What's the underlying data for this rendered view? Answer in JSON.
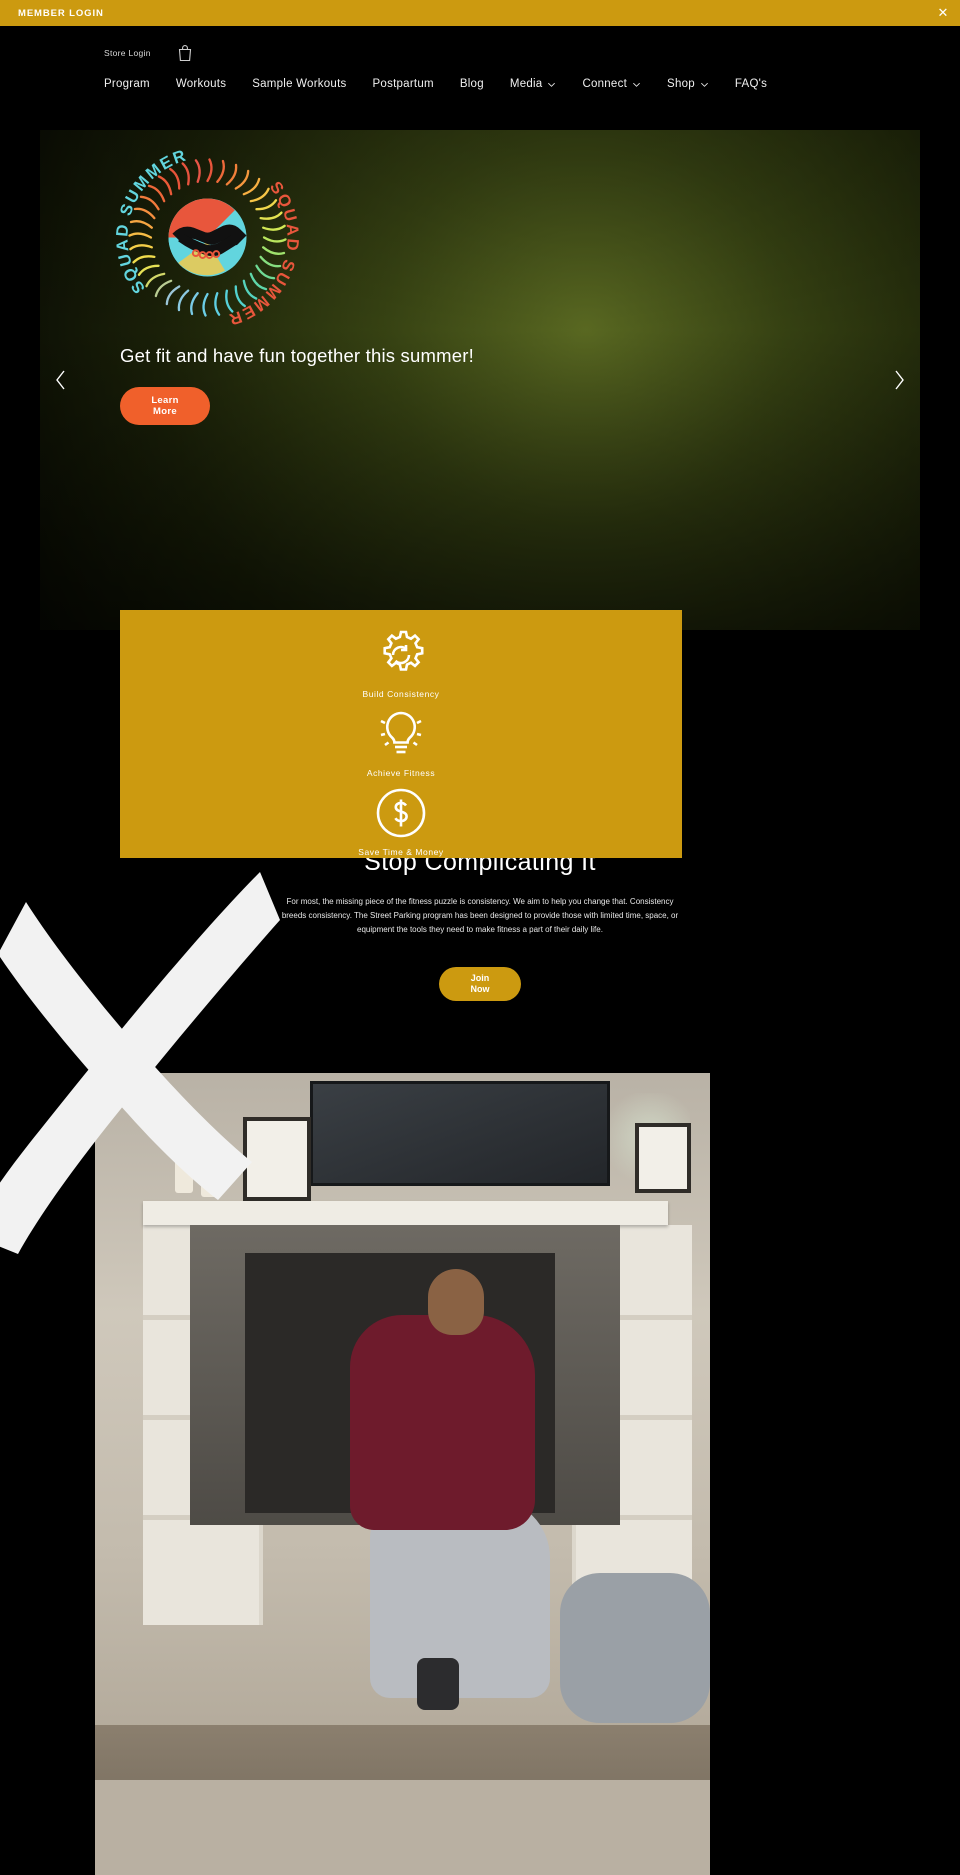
{
  "member_bar": {
    "text": "MEMBER LOGIN",
    "close_icon": "close-icon",
    "bg_color": "#CC9A10"
  },
  "header": {
    "store_login": "Store Login",
    "bag_icon": "shopping-bag-icon",
    "nav": [
      {
        "label": "Program",
        "has_caret": false
      },
      {
        "label": "Workouts",
        "has_caret": false
      },
      {
        "label": "Sample Workouts",
        "has_caret": false
      },
      {
        "label": "Postpartum",
        "has_caret": false
      },
      {
        "label": "Blog",
        "has_caret": false
      },
      {
        "label": "Media",
        "has_caret": true
      },
      {
        "label": "Connect",
        "has_caret": true
      },
      {
        "label": "Shop",
        "has_caret": true
      },
      {
        "label": "FAQ's",
        "has_caret": false
      }
    ]
  },
  "hero": {
    "logo_text_outer": "SQUAD SUMMER",
    "logo_text_inner": "SQUAD SUMMER",
    "title": "Get fit and have fun together this summer!",
    "cta_line1": "Learn",
    "cta_line2": "More",
    "cta_color": "#F0602B",
    "prev_arrow": "chevron-left-icon",
    "next_arrow": "chevron-right-icon"
  },
  "features": {
    "bg_color": "#CC9A10",
    "items": [
      {
        "icon": "gear-refresh-icon",
        "label": "Build Consistency"
      },
      {
        "icon": "lightbulb-icon",
        "label": "Achieve Fitness"
      },
      {
        "icon": "dollar-circle-icon",
        "label": "Save Time & Money"
      }
    ]
  },
  "stop_section": {
    "title": "Stop Complicating It",
    "paragraph": "For most, the missing piece of the fitness puzzle is consistency. We aim to help you change that. Consistency breeds consistency. The Street Parking program has been designed to provide those with limited time, space, or equipment the tools they need to make fitness a part of their daily life.",
    "cta_line1": "Join",
    "cta_line2": "Now",
    "cta_color": "#CC9A10"
  },
  "photo": {
    "alt": "man-doing-kettlebell-exercise-in-living-room"
  }
}
